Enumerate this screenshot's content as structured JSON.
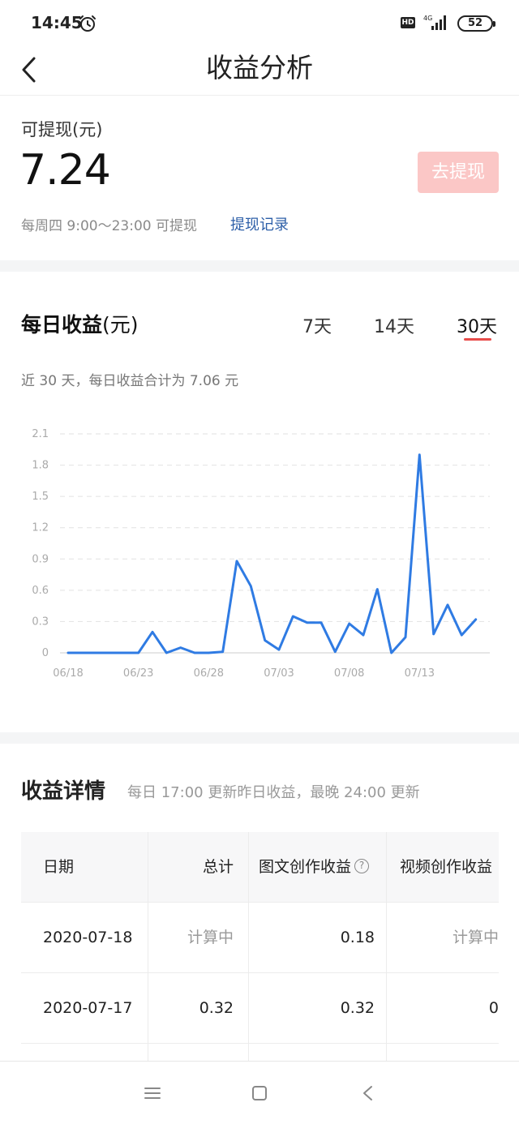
{
  "status_bar": {
    "time": "14:45",
    "hd_label": "HD",
    "network_label": "4G",
    "battery_level": "52"
  },
  "nav": {
    "title": "收益分析",
    "back_icon": "chevron-left-icon"
  },
  "balance": {
    "label": "可提现(元)",
    "amount": "7.24",
    "withdraw_button": "去提现",
    "note": "每周四 9:00～23:00 可提现",
    "history_link": "提现记录"
  },
  "daily": {
    "title": "每日收益",
    "title_unit": "(元)",
    "tabs": [
      {
        "label": "7天",
        "active": false
      },
      {
        "label": "14天",
        "active": false
      },
      {
        "label": "30天",
        "active": true
      }
    ],
    "summary": "近 30 天，每日收益合计为 7.06 元"
  },
  "chart_data": {
    "type": "line",
    "ylim": [
      0,
      2.1
    ],
    "yticks": [
      "0",
      "0.3",
      "0.6",
      "0.9",
      "1.2",
      "1.5",
      "1.8",
      "2.1"
    ],
    "xtick_labels": [
      "06/18",
      "06/23",
      "06/28",
      "07/03",
      "07/08",
      "07/13"
    ],
    "grid": true,
    "line_color": "#2f7be3",
    "series": [
      {
        "x": [
          "06/18",
          "06/19",
          "06/20",
          "06/21",
          "06/22",
          "06/23",
          "06/24",
          "06/25",
          "06/26",
          "06/27",
          "06/28",
          "06/29",
          "06/30",
          "07/01",
          "07/02",
          "07/03",
          "07/04",
          "07/05",
          "07/06",
          "07/07",
          "07/08",
          "07/09",
          "07/10",
          "07/11",
          "07/12",
          "07/13",
          "07/14",
          "07/15",
          "07/16",
          "07/17",
          "07/18"
        ],
        "values": [
          0,
          0,
          0,
          0,
          0,
          0,
          0.2,
          0,
          0.05,
          0,
          0,
          0.01,
          0.88,
          0.64,
          0.12,
          0.03,
          0.35,
          0.29,
          0.29,
          0.01,
          0.28,
          0.17,
          0.61,
          0,
          0.15,
          1.9,
          0.18,
          0.46,
          0.17,
          0.32,
          null
        ]
      }
    ]
  },
  "details": {
    "title": "收益详情",
    "note": "每日 17:00 更新昨日收益，最晚 24:00 更新",
    "columns": [
      "日期",
      "总计",
      "图文创作收益",
      "视频创作收益"
    ],
    "rows": [
      [
        "2020-07-18",
        "计算中",
        "0.18",
        "计算中"
      ],
      [
        "2020-07-17",
        "0.32",
        "0.32",
        "0"
      ]
    ]
  },
  "system_nav": {
    "menu_icon": "menu-icon",
    "home_icon": "home-square-icon",
    "back_icon": "back-triangle-icon"
  }
}
